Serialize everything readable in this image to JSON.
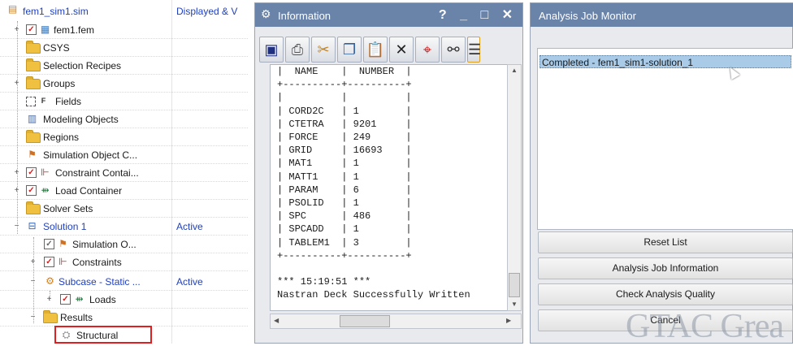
{
  "navigator": {
    "root_label": "fem1_sim1.sim",
    "column2_header": "Displayed & V",
    "items": [
      {
        "label": "fem1.fem",
        "status": ""
      },
      {
        "label": "CSYS",
        "status": ""
      },
      {
        "label": "Selection Recipes",
        "status": ""
      },
      {
        "label": "Groups",
        "status": ""
      },
      {
        "label": "Fields",
        "status": ""
      },
      {
        "label": "Modeling Objects",
        "status": ""
      },
      {
        "label": "Regions",
        "status": ""
      },
      {
        "label": "Simulation Object C...",
        "status": ""
      },
      {
        "label": "Constraint Contai...",
        "status": ""
      },
      {
        "label": "Load Container",
        "status": ""
      },
      {
        "label": "Solver Sets",
        "status": ""
      },
      {
        "label": "Solution 1",
        "status": "Active"
      },
      {
        "label": "Simulation O...",
        "status": ""
      },
      {
        "label": "Constraints",
        "status": ""
      },
      {
        "label": "Subcase - Static ...",
        "status": "Active"
      },
      {
        "label": "Loads",
        "status": ""
      },
      {
        "label": "Results",
        "status": ""
      },
      {
        "label": "Structural",
        "status": ""
      }
    ]
  },
  "info_window": {
    "title": "Information",
    "title_buttons": "? _ □ ✕",
    "text": "|  NAME    |  NUMBER  |\n+----------+----------+\n|          |          |\n| CORD2C   | 1        |\n| CTETRA   | 9201     |\n| FORCE    | 249      |\n| GRID     | 16693    |\n| MAT1     | 1        |\n| MATT1    | 1        |\n| PARAM    | 6        |\n| PSOLID   | 1        |\n| SPC      | 486      |\n| SPCADD   | 1        |\n| TABLEM1  | 3        |\n+----------+----------+\n\n*** 15:19:51 ***\nNastran Deck Successfully Written"
  },
  "job_monitor": {
    "title": "Analysis Job Monitor",
    "list_items": [
      "Completed - fem1_sim1-solution_1"
    ],
    "buttons": {
      "reset": "Reset List",
      "info": "Analysis Job Information",
      "quality": "Check Analysis Quality",
      "cancel": "Cancel"
    }
  },
  "watermark": "GTAC Grea"
}
